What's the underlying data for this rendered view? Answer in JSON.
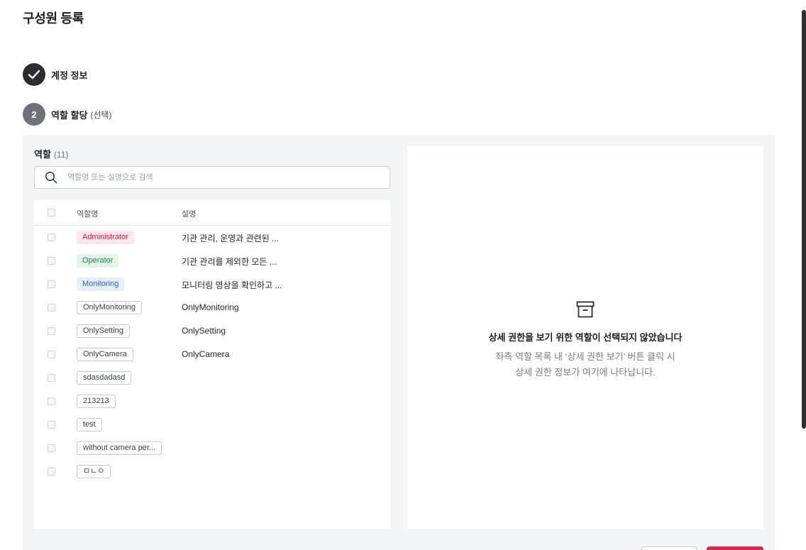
{
  "dialog": {
    "title": "구성원 등록"
  },
  "steps": [
    {
      "label": "계정 정보",
      "status": "done",
      "icon": "check-icon"
    },
    {
      "number": "2",
      "label": "역할 할당",
      "sub": "(선택)",
      "status": "active"
    }
  ],
  "roles": {
    "title": "역할",
    "count": "(11)",
    "search_placeholder": "역할명 또는 설명으로 검색",
    "columns": {
      "name": "역할명",
      "description": "설명"
    },
    "rows": [
      {
        "name": "Administrator",
        "description": "기관 관리, 운영과 관련된 ...",
        "color": "#c8233a"
      },
      {
        "name": "Operator",
        "description": "기관 관리를 제외한 모든 ...",
        "color": "#21884a"
      },
      {
        "name": "Monitoring",
        "description": "모니터링 영상을 확인하고 ...",
        "color": "#2b68b3"
      },
      {
        "name": "OnlyMonitoring",
        "description": "OnlyMonitoring"
      },
      {
        "name": "OnlySetting",
        "description": "OnlySetting"
      },
      {
        "name": "OnlyCamera",
        "description": "OnlyCamera"
      },
      {
        "name": "sdasdadasd",
        "description": ""
      },
      {
        "name": "213213",
        "description": ""
      },
      {
        "name": "test",
        "description": ""
      },
      {
        "name": "without camera per...",
        "description": ""
      },
      {
        "name": "ㅁㄴㅇ",
        "description": ""
      }
    ]
  },
  "detail": {
    "icon": "archive-icon",
    "empty_title": "상세 권한을 보기 위한 역할이 선택되지 않았습니다",
    "empty_line1": "좌측 역할 목록 내 ‘상세 권한 보기’ 버튼 클릭 시",
    "empty_line2": "상세 권한 정보가 여기에 나타납니다."
  },
  "colors": {
    "primary": "#d22a4a",
    "panel": "#f4f5f7"
  }
}
